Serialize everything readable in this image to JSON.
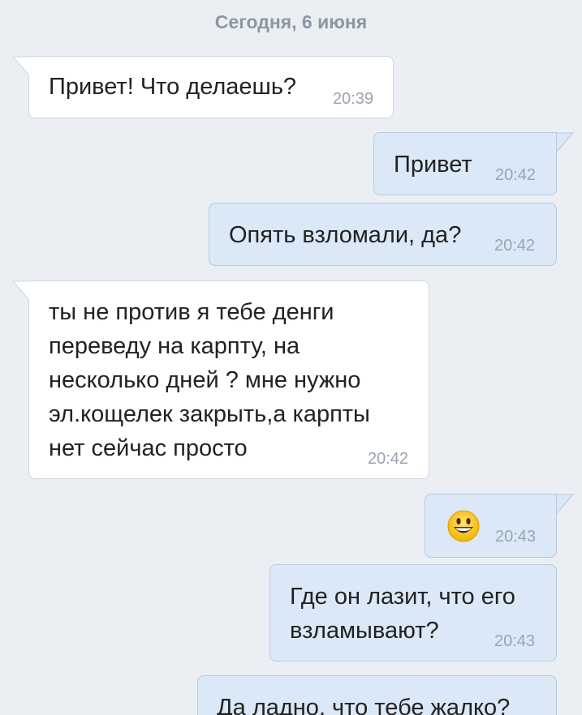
{
  "date_separator": "Сегодня, 6 июня",
  "messages": [
    {
      "direction": "in",
      "text": "Привет! Что делаешь?",
      "time": "20:39"
    },
    {
      "direction": "out",
      "text": "Привет",
      "time": "20:42"
    },
    {
      "direction": "out",
      "text": "Опять взломали, да?",
      "time": "20:42"
    },
    {
      "direction": "in",
      "text": "ты не против я тебе денги\nпереведу на карпту, на\nнесколько дней ? мне нужно\nэл.кощелек закрыть,а карпты\nнет сейчас просто",
      "time": "20:42"
    },
    {
      "direction": "out",
      "text": "",
      "emoji": "smiling-face-emoji",
      "time": "20:43"
    },
    {
      "direction": "out",
      "text": "Где он лазит, что его\nвзламывают?",
      "time": "20:43"
    },
    {
      "direction": "out",
      "text": "Да ладно, что тебе жалко?",
      "time": ""
    }
  ],
  "colors": {
    "background": "#ebeff4",
    "incoming_bubble": "#ffffff",
    "outgoing_bubble": "#dbe8f7",
    "timestamp": "#9aa4b0",
    "date_separator": "#8c96a3"
  }
}
